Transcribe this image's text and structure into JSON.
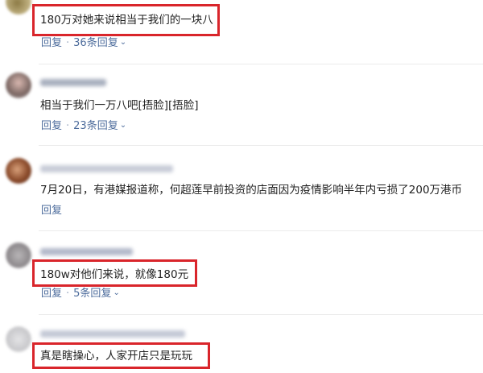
{
  "colors": {
    "link": "#4d6c9c",
    "highlight_box": "#d9252b",
    "text": "#222222"
  },
  "comments": [
    {
      "text": "180万对她来说相当于我们的一块八",
      "reply_label": "回复",
      "separator": "·",
      "replies_label": "36条回复",
      "chevron": "⌄"
    },
    {
      "text": "相当于我们一万八吧[捂脸][捂脸]",
      "reply_label": "回复",
      "separator": "·",
      "replies_label": "23条回复",
      "chevron": "⌄"
    },
    {
      "text": "7月20日，有港媒报道称，何超莲早前投资的店面因为疫情影响半年内亏损了200万港币",
      "reply_label": "回复"
    },
    {
      "text": "180w对他们来说，就像180元",
      "reply_label": "回复",
      "separator": "·",
      "replies_label": "5条回复",
      "chevron": "⌄"
    },
    {
      "text": "真是瞎操心，人家开店只是玩玩"
    }
  ]
}
